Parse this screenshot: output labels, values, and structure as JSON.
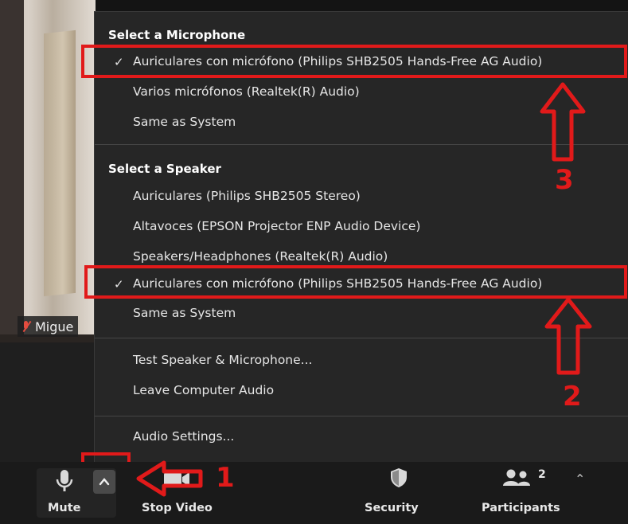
{
  "video": {
    "participant_name": "Migue"
  },
  "menu": {
    "mic_section_title": "Select a Microphone",
    "mic_items": [
      "Auriculares con micrófono (Philips SHB2505 Hands-Free AG Audio)",
      "Varios micrófonos (Realtek(R) Audio)",
      "Same as System"
    ],
    "speaker_section_title": "Select a Speaker",
    "speaker_items": [
      "Auriculares (Philips SHB2505 Stereo)",
      "Altavoces (EPSON Projector ENP Audio Device)",
      "Speakers/Headphones (Realtek(R) Audio)",
      "Auriculares con micrófono (Philips SHB2505 Hands-Free AG Audio)",
      "Same as System"
    ],
    "check_mark": "✓",
    "test_label": "Test Speaker & Microphone...",
    "leave_label": "Leave Computer Audio",
    "settings_label": "Audio Settings..."
  },
  "annotations": {
    "num_1": "1",
    "num_2": "2",
    "num_3": "3",
    "color": "#e11a1a"
  },
  "toolbar": {
    "mute_label": "Mute",
    "stop_video_label": "Stop Video",
    "security_label": "Security",
    "participants_label": "Participants",
    "participants_count": "2"
  }
}
